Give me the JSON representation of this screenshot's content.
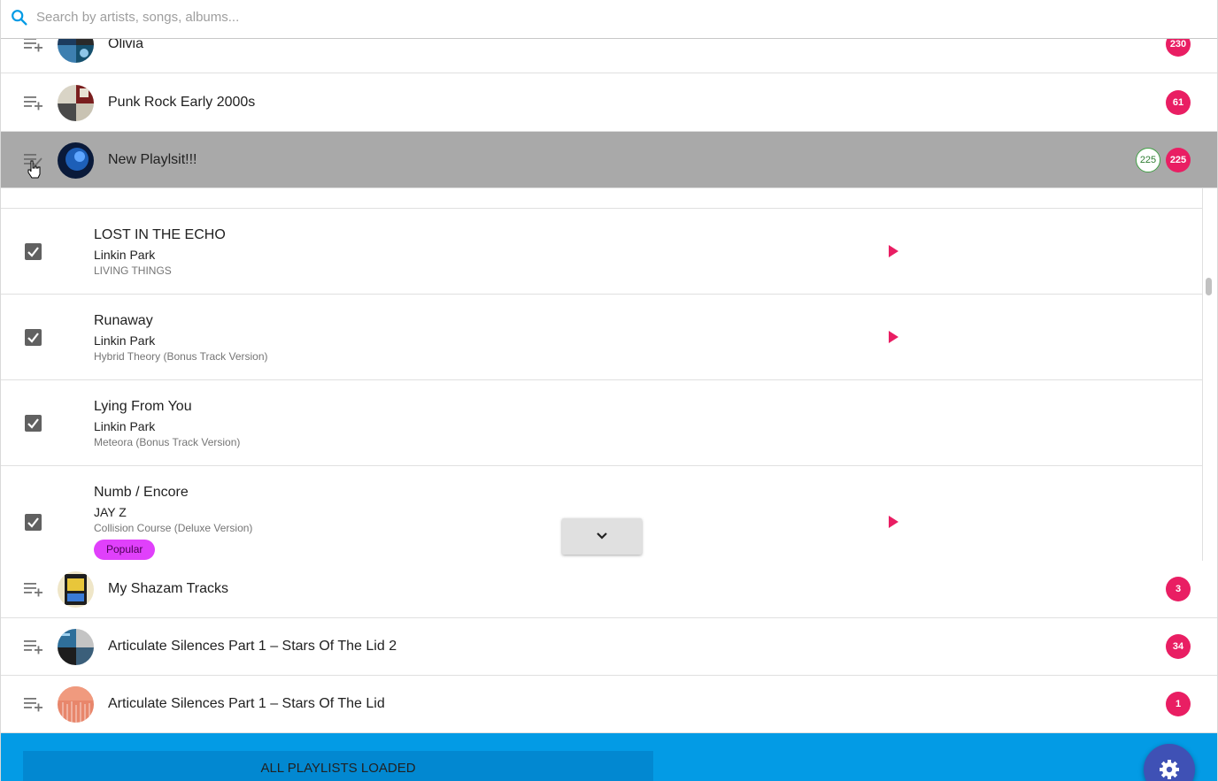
{
  "search": {
    "placeholder": "Search by artists, songs, albums...",
    "icon": "search-icon",
    "accent": "#039be5"
  },
  "playlists_top": [
    {
      "name": "Olivia",
      "count": "230"
    },
    {
      "name": "Punk Rock Early 2000s",
      "count": "61"
    },
    {
      "name": "New Playlsit!!!",
      "count": "225",
      "selected_count": "225",
      "selected": true
    }
  ],
  "tracks": [
    {
      "title": "LOST IN THE ECHO",
      "artist": "Linkin Park",
      "album": "LIVING THINGS",
      "checked": true,
      "playable": true
    },
    {
      "title": "Runaway",
      "artist": "Linkin Park",
      "album": "Hybrid Theory (Bonus Track Version)",
      "checked": true,
      "playable": true
    },
    {
      "title": "Lying From You",
      "artist": "Linkin Park",
      "album": "Meteora (Bonus Track Version)",
      "checked": true,
      "playable": false
    },
    {
      "title": "Numb / Encore",
      "artist": "JAY Z",
      "album": "Collision Course (Deluxe Version)",
      "checked": true,
      "playable": true,
      "tag": "Popular"
    }
  ],
  "playlists_bottom": [
    {
      "name": "My Shazam Tracks",
      "count": "3"
    },
    {
      "name": "Articulate Silences Part 1 – Stars Of The Lid 2",
      "count": "34"
    },
    {
      "name": "Articulate Silences Part 1 – Stars Of The Lid",
      "count": "1"
    }
  ],
  "footer": {
    "status": "ALL PLAYLISTS LOADED",
    "settings_icon": "gear-icon"
  },
  "colors": {
    "badge": "#e91e63",
    "selected_row": "#a9a9a9",
    "footer": "#039be5",
    "fab": "#3f51b5",
    "popular_chip": "#e040fb"
  }
}
